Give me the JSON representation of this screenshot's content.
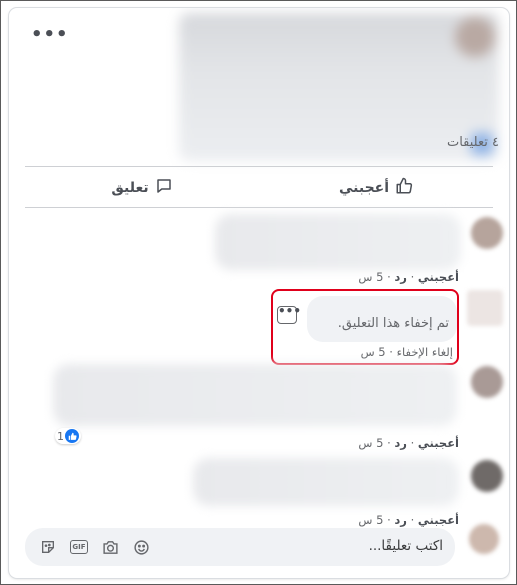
{
  "post": {
    "comments_count": "٤ تعليقات"
  },
  "actions": {
    "like_label": "أعجبني",
    "comment_label": "تعليق"
  },
  "comments": [
    {
      "like": "أعجبني",
      "reply": "رد",
      "time": "5 س"
    },
    {
      "hidden_text": "تم إخفاء هذا التعليق.",
      "unhide": "إلغاء الإخفاء",
      "time": "5 س"
    },
    {
      "like": "أعجبني",
      "reply": "رد",
      "time": "5 س",
      "reactions": "1"
    },
    {
      "like": "أعجبني",
      "reply": "رد",
      "time": "5 س"
    }
  ],
  "composer": {
    "placeholder": "اكتب تعليقًا..."
  },
  "icons": [
    "more-icon",
    "like-icon",
    "comment-icon",
    "sticker-icon",
    "gif-icon",
    "camera-icon",
    "emoji-icon"
  ],
  "colors": {
    "highlight": "#e0001b",
    "like_blue": "#1877f2"
  }
}
